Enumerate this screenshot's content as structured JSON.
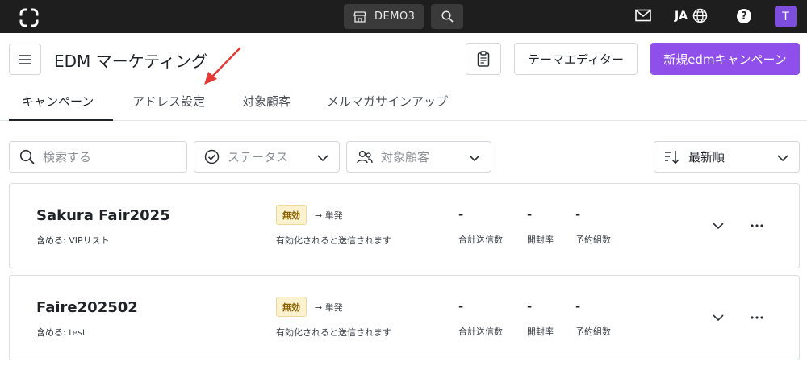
{
  "topbar": {
    "store_label": "DEMO3",
    "lang": "JA",
    "help": "?",
    "avatar": "T",
    "icons": [
      "logo-icon",
      "store-icon",
      "search-icon",
      "mail-icon",
      "globe-icon",
      "help-icon"
    ]
  },
  "header": {
    "title": "EDM マーケティング",
    "theme_editor": "テーマエディター",
    "new_campaign": "新規edmキャンペーン"
  },
  "tabs": [
    {
      "label": "キャンペーン",
      "active": true
    },
    {
      "label": "アドレス設定",
      "active": false
    },
    {
      "label": "対象顧客",
      "active": false
    },
    {
      "label": "メルマガサインアップ",
      "active": false
    }
  ],
  "filters": {
    "search_placeholder": "検索する",
    "status": "ステータス",
    "target": "対象顧客",
    "sort": "最新順"
  },
  "campaigns": [
    {
      "name": "Sakura Fair2025",
      "include": "含める: VIPリスト",
      "status": "無効",
      "mode": "→ 単発",
      "note": "有効化されると送信されます",
      "metrics": [
        {
          "value": "-",
          "label": "合計送信数"
        },
        {
          "value": "-",
          "label": "開封率"
        },
        {
          "value": "-",
          "label": "予約組数"
        }
      ]
    },
    {
      "name": "Faire202502",
      "include": "含める: test",
      "status": "無効",
      "mode": "→ 単発",
      "note": "有効化されると送信されます",
      "metrics": [
        {
          "value": "-",
          "label": "合計送信数"
        },
        {
          "value": "-",
          "label": "開封率"
        },
        {
          "value": "-",
          "label": "予約組数"
        }
      ]
    }
  ],
  "colors": {
    "topbar": "#1e1e1e",
    "primary": "#8f4fea",
    "avatar": "#7d4dde",
    "badge_bg": "#fdf2cf",
    "badge_text": "#8a6100",
    "annotation_arrow": "#e53935"
  }
}
